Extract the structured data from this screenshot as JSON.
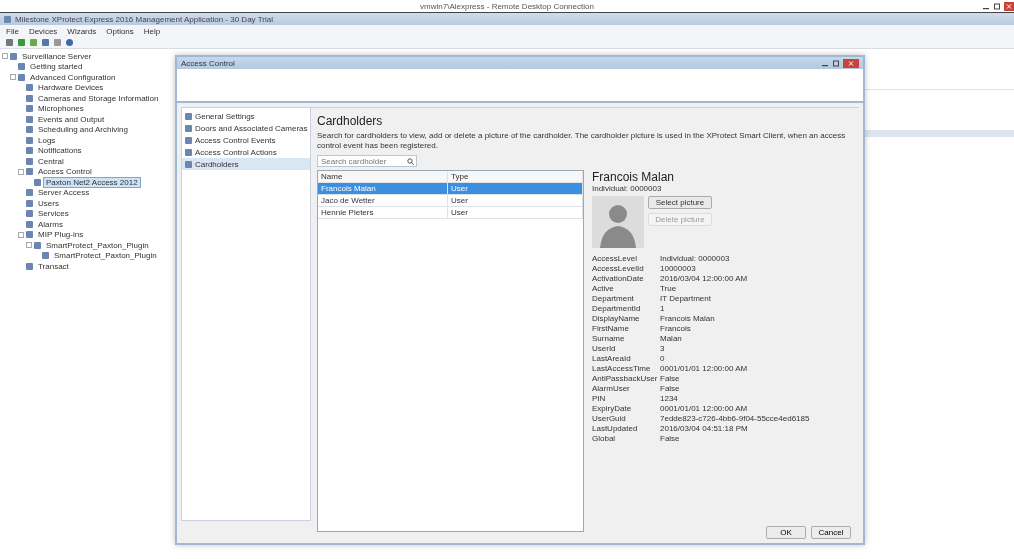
{
  "remote_window": {
    "title": "vmwin7\\Alexpress - Remote Desktop Connection"
  },
  "app": {
    "title": "Milestone XProtect Express 2016 Management Application - 30 Day Trial",
    "menu": [
      "File",
      "Devices",
      "Wizards",
      "Options",
      "Help"
    ],
    "tree": [
      {
        "label": "Surveillance Server",
        "selected": false,
        "children": [
          {
            "label": "Getting started",
            "selected": false
          },
          {
            "label": "Advanced Configuration",
            "selected": false,
            "children": [
              {
                "label": "Hardware Devices",
                "selected": false
              },
              {
                "label": "Cameras and Storage Information",
                "selected": false
              },
              {
                "label": "Microphones",
                "selected": false
              },
              {
                "label": "Events and Output",
                "selected": false
              },
              {
                "label": "Scheduling and Archiving",
                "selected": false
              },
              {
                "label": "Logs",
                "selected": false
              },
              {
                "label": "Notifications",
                "selected": false
              },
              {
                "label": "Central",
                "selected": false
              },
              {
                "label": "Access Control",
                "selected": false,
                "children": [
                  {
                    "label": "Paxton Net2 Access 2012",
                    "selected": true
                  }
                ]
              },
              {
                "label": "Server Access",
                "selected": false
              },
              {
                "label": "Users",
                "selected": false
              },
              {
                "label": "Services",
                "selected": false
              },
              {
                "label": "Alarms",
                "selected": false
              },
              {
                "label": "MIP Plug-ins",
                "selected": false,
                "children": [
                  {
                    "label": "SmartProtect_Paxton_Plugin",
                    "selected": false,
                    "children": [
                      {
                        "label": "SmartProtect_Paxton_Plugin",
                        "selected": false
                      }
                    ]
                  }
                ]
              },
              {
                "label": "Transact",
                "selected": false
              }
            ]
          }
        ]
      }
    ]
  },
  "dialog": {
    "title": "Access Control",
    "nav": [
      {
        "label": "General Settings",
        "selected": false
      },
      {
        "label": "Doors and Associated Cameras",
        "selected": false
      },
      {
        "label": "Access Control Events",
        "selected": false
      },
      {
        "label": "Access Control Actions",
        "selected": false
      },
      {
        "label": "Cardholders",
        "selected": true
      }
    ],
    "heading": "Cardholders",
    "description": "Search for cardholders to view, add or delete a picture of the cardholder. The cardholder picture is used in the XProtect Smart Client, when an access control event has been registered.",
    "search": {
      "placeholder": "Search cardholder"
    },
    "table": {
      "columns": [
        "Name",
        "Type"
      ],
      "rows": [
        {
          "cells": [
            "Francois Malan",
            "User"
          ],
          "selected": true
        },
        {
          "cells": [
            "Jaco de Wetter",
            "User"
          ],
          "selected": false
        },
        {
          "cells": [
            "Hennie Pieters",
            "User"
          ],
          "selected": false
        }
      ]
    },
    "detail": {
      "name": "Francois Malan",
      "subtitle": "Individual: 0000003",
      "buttons": [
        {
          "label": "Select picture",
          "disabled": false
        },
        {
          "label": "Delete picture",
          "disabled": true
        }
      ],
      "properties": [
        [
          "AccessLevel",
          "Individual: 0000003"
        ],
        [
          "AccessLevelId",
          "10000003"
        ],
        [
          "ActivationDate",
          "2016/03/04 12:00:00 AM"
        ],
        [
          "Active",
          "True"
        ],
        [
          "Department",
          "IT Department"
        ],
        [
          "DepartmentId",
          "1"
        ],
        [
          "DisplayName",
          "Francois Malan"
        ],
        [
          "FirstName",
          "Francois"
        ],
        [
          "Surname",
          "Malan"
        ],
        [
          "UserId",
          "3"
        ],
        [
          "LastAreaId",
          "0"
        ],
        [
          "LastAccessTime",
          "0001/01/01 12:00:00 AM"
        ],
        [
          "AntiPassbackUser",
          "False"
        ],
        [
          "AlarmUser",
          "False"
        ],
        [
          "PIN",
          "1234"
        ],
        [
          "ExpiryDate",
          "0001/01/01 12:00:00 AM"
        ],
        [
          "UserGuid",
          "7edde823-c726-4bb6-9f04-55cce4ed6185"
        ],
        [
          "LastUpdated",
          "2016/03/04 04:51:18 PM"
        ],
        [
          "Global",
          "False"
        ]
      ]
    },
    "buttons": [
      "OK",
      "Cancel"
    ]
  }
}
